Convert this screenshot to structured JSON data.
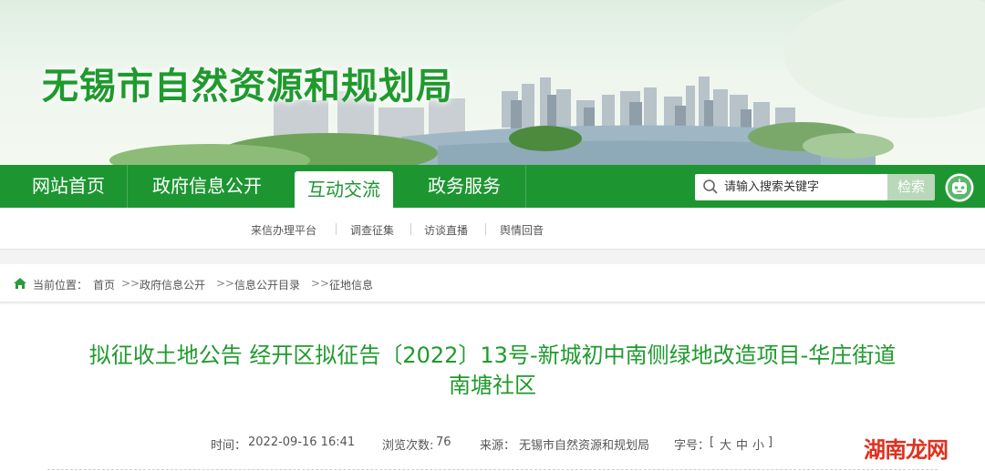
{
  "site": {
    "title": "无锡市自然资源和规划局"
  },
  "nav": {
    "items": [
      "网站首页",
      "政府信息公开",
      "互动交流",
      "政务服务"
    ],
    "active": "互动交流"
  },
  "search": {
    "placeholder": "请输入搜索关键字",
    "button": "检索"
  },
  "subnav": {
    "items": [
      "来信办理平台",
      "调查征集",
      "访谈直播",
      "舆情回音"
    ]
  },
  "breadcrumb": {
    "prefix": "当前位置：",
    "items": [
      "首页",
      "政府信息公开",
      "信息公开目录",
      "征地信息"
    ],
    "separator": ">>"
  },
  "article": {
    "title_line1": "拟征收土地公告 经开区拟征告〔2022〕13号-新城初中南侧绿地改造项目-华庄街道",
    "title_line2": "南塘社区",
    "time_label": "时间：",
    "time": "2022-09-16 16:41",
    "views_label": "浏览次数:",
    "views": "76",
    "source_label": "来源：",
    "source": "无锡市自然资源和规划局",
    "font_label": "字号：",
    "font_open": "[",
    "font_sizes": [
      "大",
      "中",
      "小"
    ],
    "font_close": "]"
  },
  "watermark": {
    "text": "湖南龙网"
  },
  "colors": {
    "brand_green": "#1d9632",
    "title_green": "#1f9a2d",
    "watermark_red": "#e0301e"
  }
}
